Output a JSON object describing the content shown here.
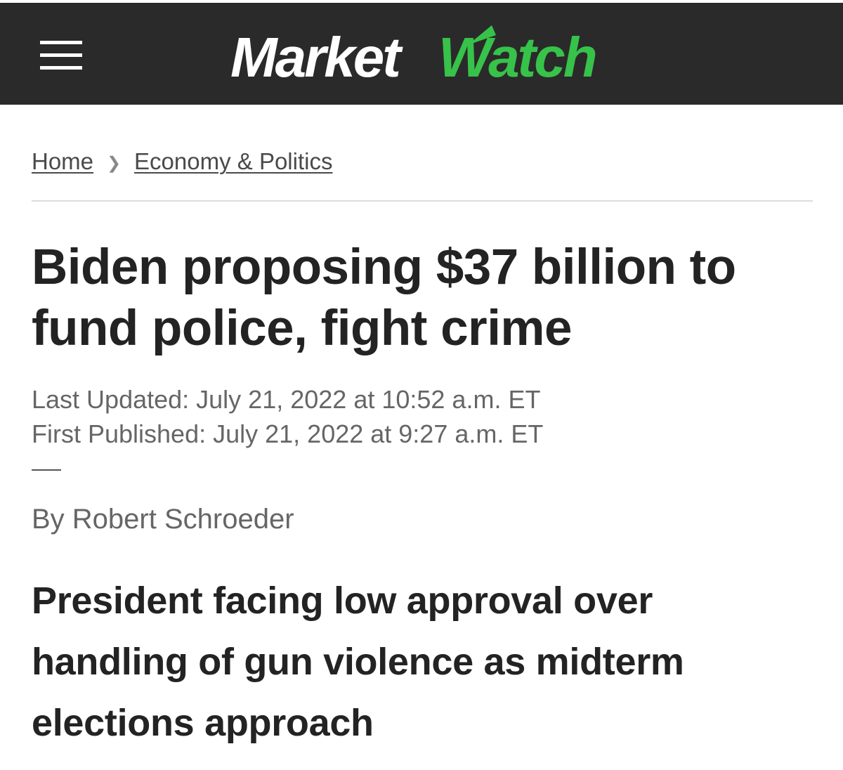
{
  "header": {
    "menu_icon": "hamburger-menu-icon",
    "logo_part1": "Market",
    "logo_part2": "Watch",
    "colors": {
      "bar": "#2a2a2a",
      "logo_white": "#ffffff",
      "logo_green": "#37c24a"
    }
  },
  "breadcrumb": {
    "items": [
      "Home",
      "Economy & Politics"
    ],
    "separator_icon": "chevron-right-icon"
  },
  "article": {
    "headline": "Biden proposing $37 billion to fund police, fight crime",
    "last_updated": "Last Updated: July 21, 2022 at 10:52 a.m. ET",
    "first_published": "First Published: July 21, 2022 at 9:27 a.m. ET",
    "byline_prefix": "By ",
    "author": "Robert Schroeder",
    "dek": "President facing low approval over handling of gun violence as midterm elections approach"
  }
}
